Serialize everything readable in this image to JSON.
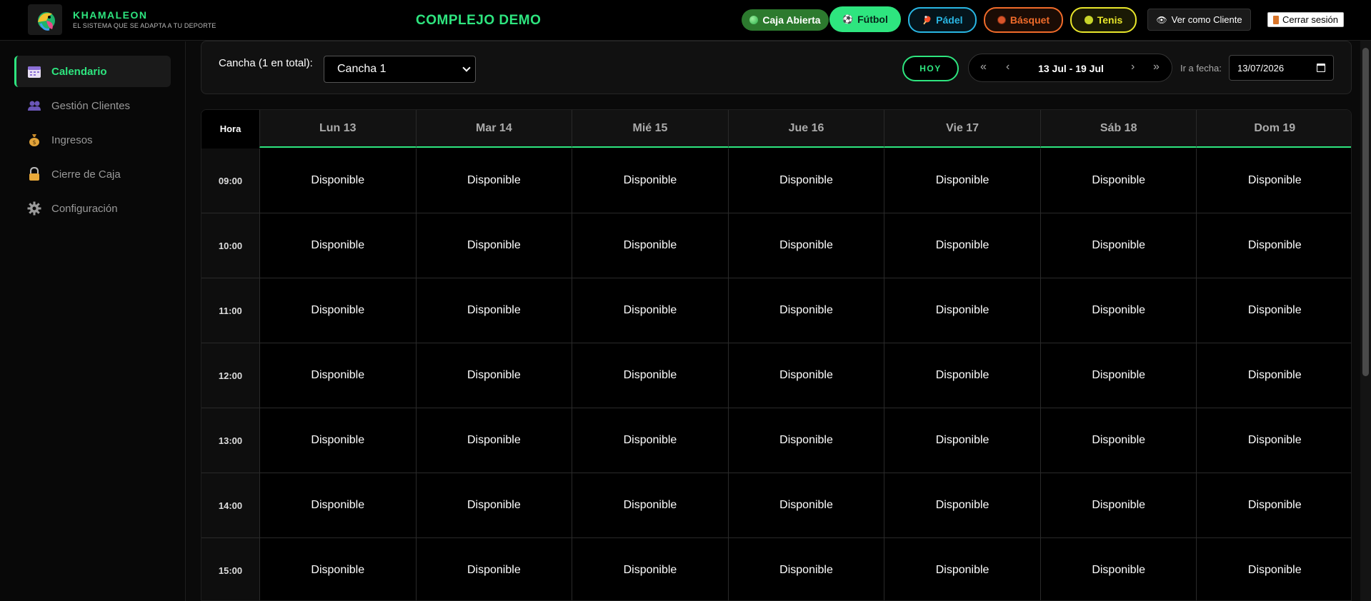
{
  "brand": {
    "name": "KHAMALEON",
    "tagline": "EL SISTEMA QUE SE ADAPTA A TU DEPORTE"
  },
  "complex_title": "COMPLEJO DEMO",
  "header": {
    "caja": "Caja Abierta",
    "sports": [
      {
        "label": "Fútbol",
        "icon": "soccer-ball-icon",
        "color": "#2ee57f",
        "active": true
      },
      {
        "label": "Pádel",
        "icon": "padel-racket-icon",
        "color": "#29b6e3",
        "active": false
      },
      {
        "label": "Básquet",
        "icon": "basketball-icon",
        "color": "#f06b2a",
        "active": false
      },
      {
        "label": "Tenis",
        "icon": "tennis-ball-icon",
        "color": "#e8e62b",
        "active": false
      }
    ],
    "ver_cliente": "Ver como Cliente",
    "logout": "Cerrar sesión"
  },
  "sidebar": {
    "items": [
      {
        "label": "Calendario",
        "icon": "calendar-icon",
        "active": true
      },
      {
        "label": "Gestión Clientes",
        "icon": "users-icon",
        "active": false
      },
      {
        "label": "Ingresos",
        "icon": "money-bag-icon",
        "active": false
      },
      {
        "label": "Cierre de Caja",
        "icon": "lock-icon",
        "active": false
      },
      {
        "label": "Configuración",
        "icon": "gear-icon",
        "active": false
      }
    ]
  },
  "toolbar": {
    "cancha_label": "Cancha (1 en total):",
    "cancha_selected": "Cancha 1",
    "hoy": "HOY",
    "prev_week": "«",
    "prev": "‹",
    "range": "13 Jul - 19 Jul",
    "next": "›",
    "next_week": "»",
    "ir_label": "Ir a fecha:",
    "date_value": "13/07/2026"
  },
  "calendar": {
    "hour_header": "Hora",
    "days": [
      "Lun 13",
      "Mar 14",
      "Mié 15",
      "Jue 16",
      "Vie 17",
      "Sáb 18",
      "Dom 19"
    ],
    "hours": [
      "09:00",
      "10:00",
      "11:00",
      "12:00",
      "13:00",
      "14:00",
      "15:00"
    ],
    "slot_label": "Disponible"
  },
  "colors": {
    "accent": "#2ee57f",
    "caja": "#2c7a2e"
  }
}
